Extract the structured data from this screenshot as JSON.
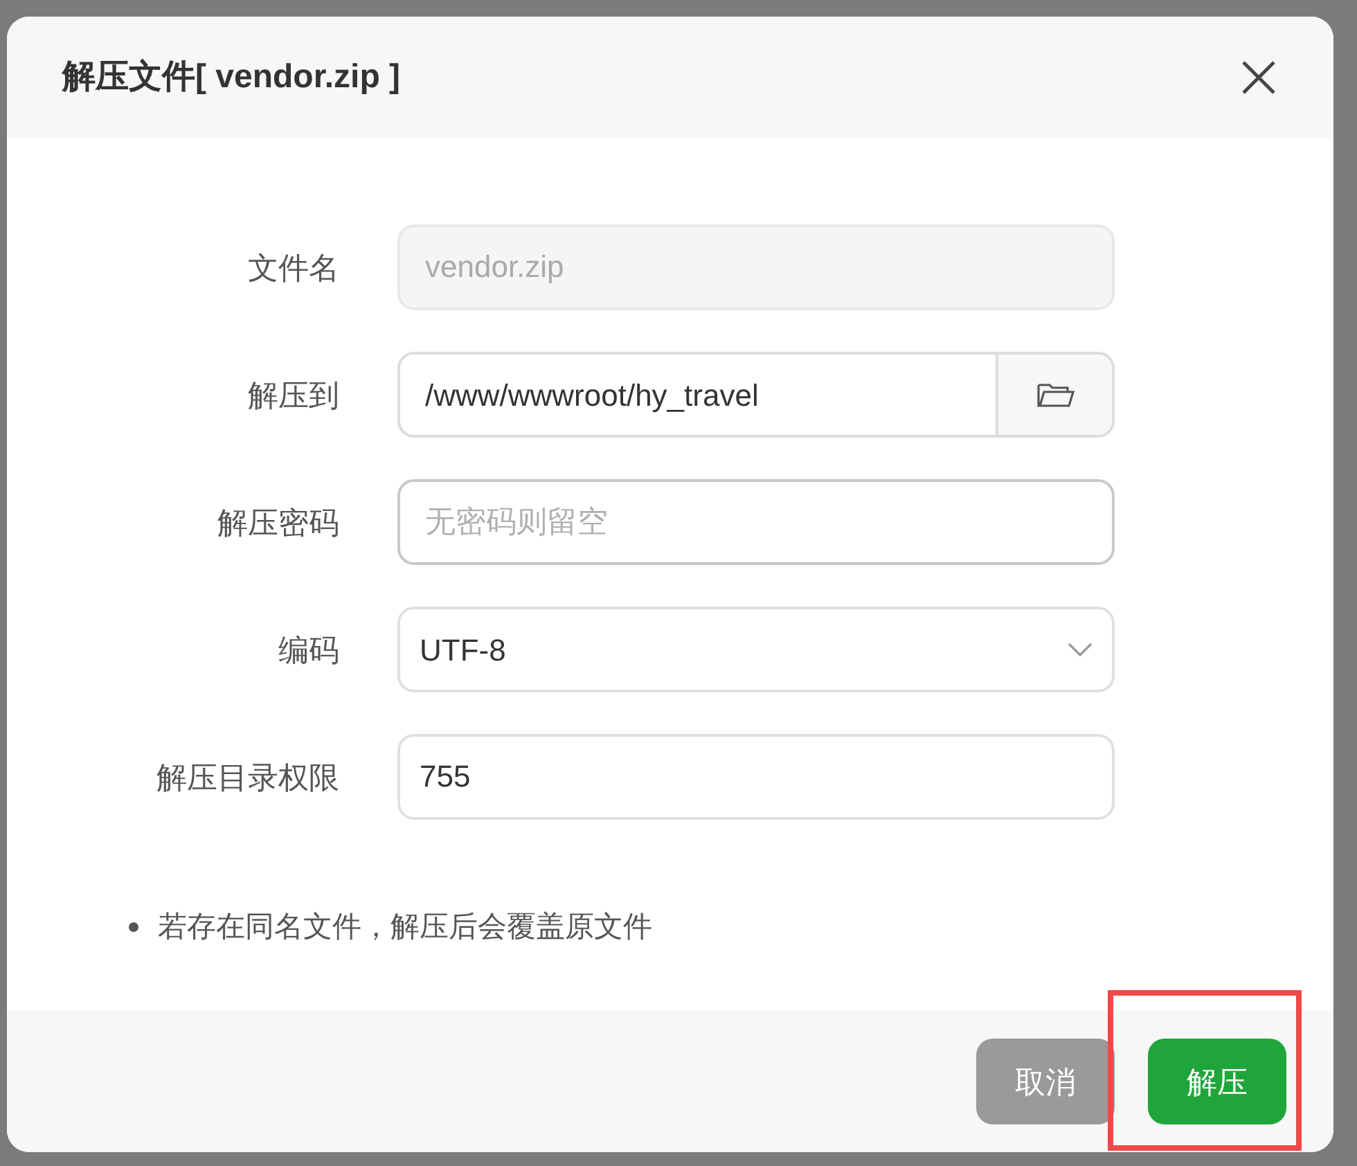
{
  "dialog": {
    "title": "解压文件[ vendor.zip ]",
    "fields": [
      {
        "kind": "readonly",
        "label": "文件名",
        "value": "vendor.zip"
      },
      {
        "kind": "folder",
        "label": "解压到",
        "value": "/www/wwwroot/hy_travel"
      },
      {
        "kind": "password",
        "label": "解压密码",
        "placeholder": "无密码则留空"
      },
      {
        "kind": "select",
        "label": "编码",
        "value": "UTF-8"
      },
      {
        "kind": "text",
        "label": "解压目录权限",
        "value": "755"
      }
    ],
    "notes": [
      "若存在同名文件，解压后会覆盖原文件"
    ],
    "buttons": [
      {
        "label": "取消",
        "kind": "secondary",
        "highlighted": false
      },
      {
        "label": "解压",
        "kind": "primary",
        "highlighted": true
      }
    ]
  }
}
